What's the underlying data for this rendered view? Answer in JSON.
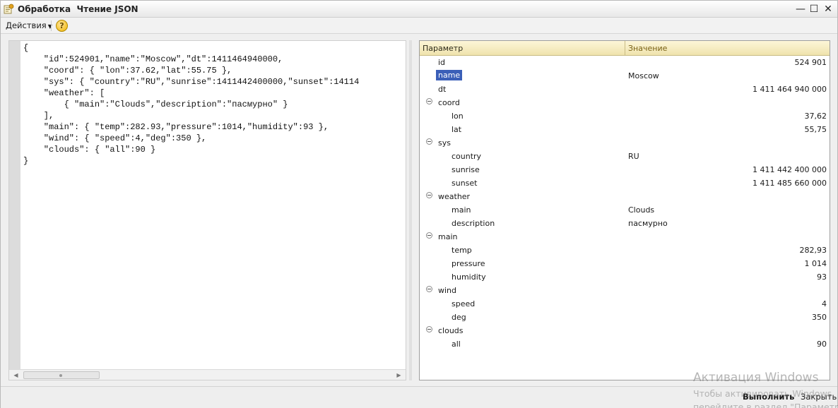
{
  "window": {
    "title": "Обработка  Чтение JSON",
    "minimize_glyph": "—",
    "maximize_glyph": "☐",
    "close_glyph": "✕"
  },
  "toolbar": {
    "actions_label": "Действия",
    "help_label": "?"
  },
  "json_source": {
    "lines": [
      "{",
      "    \"id\":524901,\"name\":\"Moscow\",\"dt\":1411464940000,",
      "    \"coord\": { \"lon\":37.62,\"lat\":55.75 },",
      "    \"sys\": { \"country\":\"RU\",\"sunrise\":1411442400000,\"sunset\":14114",
      "    \"weather\": [",
      "        { \"main\":\"Clouds\",\"description\":\"пасмурно\" }",
      "    ],",
      "    \"main\": { \"temp\":282.93,\"pressure\":1014,\"humidity\":93 },",
      "    \"wind\": { \"speed\":4,\"deg\":350 },",
      "    \"clouds\": { \"all\":90 }",
      "}"
    ]
  },
  "tree": {
    "header_param": "Параметр",
    "header_value": "Значение",
    "rows": [
      {
        "key": "id",
        "value": "524 901",
        "kind": "num",
        "level": 0,
        "group": false
      },
      {
        "key": "name",
        "value": "Moscow",
        "kind": "str",
        "level": 0,
        "group": false,
        "selected": true
      },
      {
        "key": "dt",
        "value": "1 411 464 940 000",
        "kind": "num",
        "level": 0,
        "group": false
      },
      {
        "key": "coord",
        "value": "",
        "kind": "str",
        "level": 0,
        "group": true
      },
      {
        "key": "lon",
        "value": "37,62",
        "kind": "num",
        "level": 1,
        "group": false
      },
      {
        "key": "lat",
        "value": "55,75",
        "kind": "num",
        "level": 1,
        "group": false
      },
      {
        "key": "sys",
        "value": "",
        "kind": "str",
        "level": 0,
        "group": true
      },
      {
        "key": "country",
        "value": "RU",
        "kind": "str",
        "level": 1,
        "group": false
      },
      {
        "key": "sunrise",
        "value": "1 411 442 400 000",
        "kind": "num",
        "level": 1,
        "group": false
      },
      {
        "key": "sunset",
        "value": "1 411 485 660 000",
        "kind": "num",
        "level": 1,
        "group": false
      },
      {
        "key": "weather",
        "value": "",
        "kind": "str",
        "level": 0,
        "group": true
      },
      {
        "key": "main",
        "value": "Clouds",
        "kind": "str",
        "level": 1,
        "group": false
      },
      {
        "key": "description",
        "value": "пасмурно",
        "kind": "str",
        "level": 1,
        "group": false
      },
      {
        "key": "main",
        "value": "",
        "kind": "str",
        "level": 0,
        "group": true
      },
      {
        "key": "temp",
        "value": "282,93",
        "kind": "num",
        "level": 1,
        "group": false
      },
      {
        "key": "pressure",
        "value": "1 014",
        "kind": "num",
        "level": 1,
        "group": false
      },
      {
        "key": "humidity",
        "value": "93",
        "kind": "num",
        "level": 1,
        "group": false
      },
      {
        "key": "wind",
        "value": "",
        "kind": "str",
        "level": 0,
        "group": true
      },
      {
        "key": "speed",
        "value": "4",
        "kind": "num",
        "level": 1,
        "group": false
      },
      {
        "key": "deg",
        "value": "350",
        "kind": "num",
        "level": 1,
        "group": false
      },
      {
        "key": "clouds",
        "value": "",
        "kind": "str",
        "level": 0,
        "group": true
      },
      {
        "key": "all",
        "value": "90",
        "kind": "num",
        "level": 1,
        "group": false
      }
    ]
  },
  "footer": {
    "run_label": "Выполнить",
    "close_label": "Закрыть"
  },
  "watermark": {
    "title": "Активация Windows",
    "line1": "Чтобы активировать Windows,",
    "line2": "перейдите в раздел \"Параметры\"."
  }
}
